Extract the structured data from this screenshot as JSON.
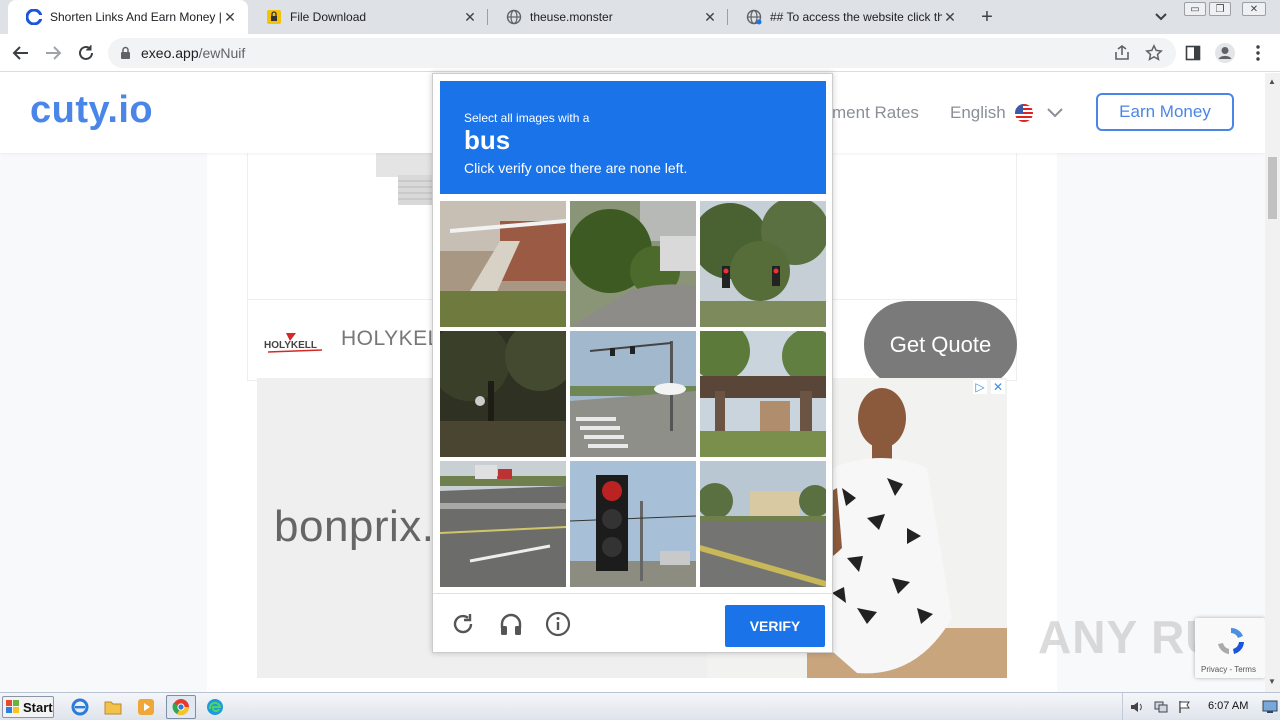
{
  "browser": {
    "tabs": [
      {
        "title": "Shorten Links And Earn Money | cuty",
        "favicon": "cuty-icon",
        "active": true
      },
      {
        "title": "File Download",
        "favicon": "lock-icon",
        "active": false
      },
      {
        "title": "theuse.monster",
        "favicon": "globe-icon",
        "active": false
      },
      {
        "title": "## To access the website click the \"/",
        "favicon": "globe-icon",
        "active": false
      }
    ],
    "url_host": "exeo.app",
    "url_path": "/ewNuif"
  },
  "site": {
    "logo": "cuty.io",
    "nav_rates": "ment Rates",
    "language": "English",
    "earn_button": "Earn Money"
  },
  "ads": {
    "top_brand": "HOLYKELL",
    "top_logo_text": "HOLYKELL",
    "quote_button": "Get Quote",
    "bottom_brand": "bonprix."
  },
  "captcha": {
    "instruction": "Select all images with a",
    "target": "bus",
    "hint": "Click verify once there are none left.",
    "verify_label": "VERIFY",
    "tiles": [
      {
        "name": "house-steps"
      },
      {
        "name": "curb-trees"
      },
      {
        "name": "traffic-lights-trees"
      },
      {
        "name": "dark-trees"
      },
      {
        "name": "intersection-crosswalk"
      },
      {
        "name": "wooden-gate"
      },
      {
        "name": "highway-truck"
      },
      {
        "name": "traffic-light-closeup"
      },
      {
        "name": "road-building"
      }
    ]
  },
  "badge": {
    "terms": "Privacy - Terms"
  },
  "watermark": "ANY RUN",
  "taskbar": {
    "start_label": "Start",
    "clock": "6:07 AM"
  },
  "colors": {
    "captcha_blue": "#1a73e8",
    "brand_blue": "#4a86e8"
  }
}
